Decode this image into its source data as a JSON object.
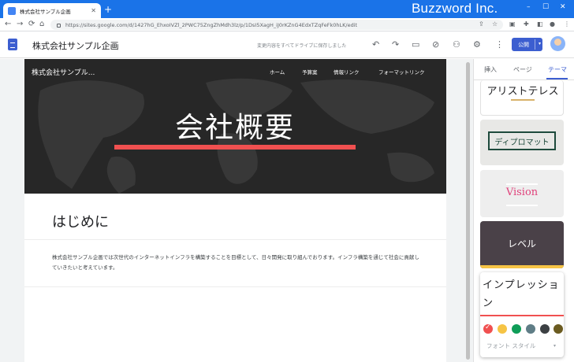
{
  "browser": {
    "tab_title": "株式会社サンプル企画",
    "tab_close": "✕",
    "new_tab": "+",
    "brand": "Buzzword Inc.",
    "url": "https://sites.google.com/d/1427hG_EhxoIVZl_2PWC75ZngZhMdh3lz/p/1DsI5XagH_iJ0rKZnG4EdxTZqFeFk0hLK/edit",
    "nav": {
      "back": "←",
      "forward": "→",
      "reload": "⟳",
      "home": "⌂"
    },
    "controls": {
      "minimize": "–",
      "maximize": "☐",
      "close": "✕"
    },
    "icons": [
      "share-icon",
      "star-icon",
      "extension-icon",
      "puzzle-icon",
      "profile-icon",
      "menu-icon"
    ]
  },
  "sites_header": {
    "title": "株式会社サンプル企画",
    "save_status": "変更内容をすべてドライブに保存しました",
    "icons": {
      "undo": "↶",
      "redo": "↷",
      "preview": "▭",
      "link": "⊘",
      "share": "⚇",
      "settings": "⚙",
      "more": "⋮"
    },
    "publish_label": "公開",
    "publish_arrow": "▾"
  },
  "page": {
    "site_name": "株式会社サンプル...",
    "nav": [
      "ホーム",
      "予算案",
      "情報リンク",
      "フォーマットリンク"
    ],
    "hero_title": "会社概要",
    "section_title": "はじめに",
    "body": "株式会社サンプル企画では次世代のインターネットインフラを構築することを目標として、日々開発に取り組んでおります。インフラ構築を通じて社会に貢献していきたいと考えています。"
  },
  "panel": {
    "tabs": [
      "挿入",
      "ページ",
      "テーマ"
    ],
    "active_tab": "テーマ",
    "themes": {
      "aristotle": "アリストテレス",
      "diplomat": "ディプロマット",
      "vision": "Vision",
      "level": "レベル",
      "impression": "インプレッション"
    },
    "swatches": [
      "#f05050",
      "#f6c445",
      "#0f9d58",
      "#5f7d86",
      "#3c4043",
      "#6b5b20"
    ],
    "selected_swatch": 0,
    "font_style_label": "フォント スタイル",
    "font_style_arrow": "▾"
  }
}
